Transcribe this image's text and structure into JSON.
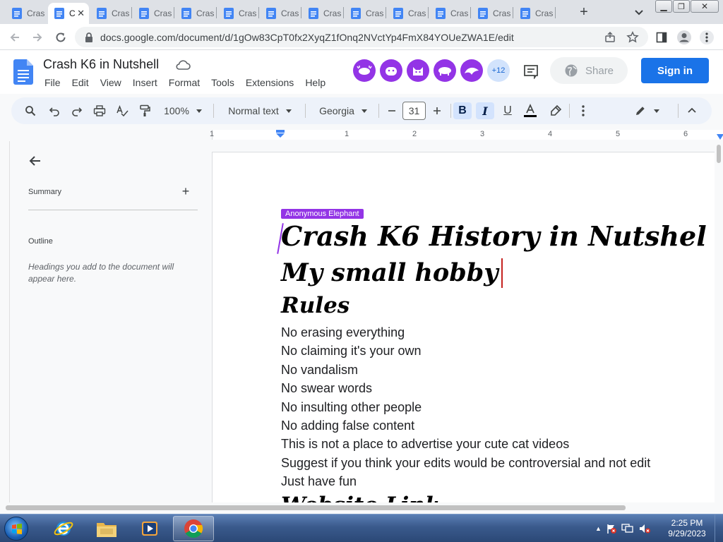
{
  "browser": {
    "tabs": [
      {
        "title": "Cras",
        "active": false
      },
      {
        "title": "C",
        "active": true
      },
      {
        "title": "Cras",
        "active": false
      },
      {
        "title": "Cras",
        "active": false
      },
      {
        "title": "Cras",
        "active": false
      },
      {
        "title": "Cras",
        "active": false
      },
      {
        "title": "Cras",
        "active": false
      },
      {
        "title": "Cras",
        "active": false
      },
      {
        "title": "Cras",
        "active": false
      },
      {
        "title": "Cras",
        "active": false
      },
      {
        "title": "Cras",
        "active": false
      },
      {
        "title": "Cras",
        "active": false
      },
      {
        "title": "Cras",
        "active": false
      }
    ],
    "url": "docs.google.com/document/d/1gOw83CpT0fx2XyqZ1fOnq2NVctYp4FmX84YOUeZWA1E/edit"
  },
  "docs": {
    "title": "Crash K6 in Nutshell",
    "menu": [
      "File",
      "Edit",
      "View",
      "Insert",
      "Format",
      "Tools",
      "Extensions",
      "Help"
    ],
    "collaborators_more": "+12",
    "share_label": "Share",
    "signin_label": "Sign in"
  },
  "toolbar": {
    "zoom": "100%",
    "style": "Normal text",
    "font": "Georgia",
    "font_size": "31"
  },
  "ruler": {
    "marks": [
      "1",
      "1",
      "2",
      "3",
      "4",
      "5",
      "6"
    ]
  },
  "sidebar": {
    "summary_label": "Summary",
    "outline_label": "Outline",
    "outline_hint": "Headings you add to the document will appear here."
  },
  "document": {
    "collaborator_cursor_name": "Anonymous Elephant",
    "heading_1": "Crash K6 History in Nutshel",
    "heading_2": "My small hobby",
    "heading_3": "Rules",
    "rules": [
      "No erasing everything",
      "No claiming it's your own",
      "No vandalism",
      "No swear words",
      "No insulting other people",
      "No adding false content",
      "This is not a place to advertise your cute cat videos",
      "Suggest if you think your edits would be controversial and not edit",
      "Just have fun"
    ],
    "heading_4": "Website Link"
  },
  "taskbar": {
    "time": "2:25 PM",
    "date": "9/29/2023"
  },
  "colors": {
    "docs_blue": "#1a73e8",
    "collaborator_purple": "#9334e6",
    "toolbar_bg": "#edf2fa"
  }
}
